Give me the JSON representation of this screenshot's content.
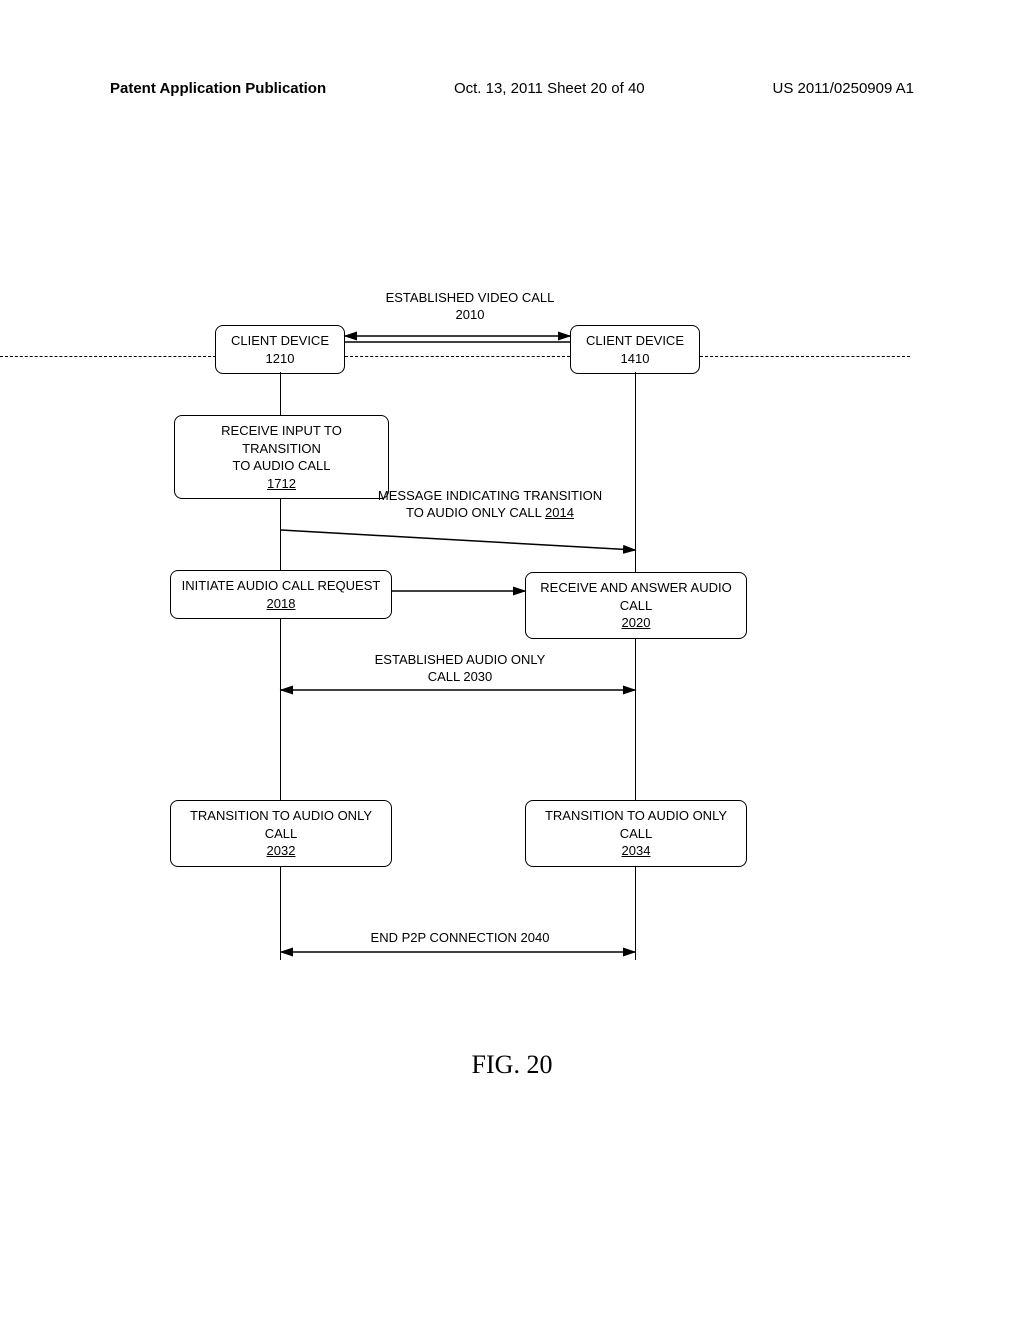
{
  "header": {
    "left": "Patent Application Publication",
    "center": "Oct. 13, 2011   Sheet 20 of 40",
    "right": "US 2011/0250909 A1"
  },
  "top_label": {
    "line1": "ESTABLISHED VIDEO CALL",
    "line2": "2010"
  },
  "client_left": {
    "line1": "CLIENT DEVICE",
    "line2": "1210"
  },
  "client_right": {
    "line1": "CLIENT DEVICE",
    "line2": "1410"
  },
  "box_receive_input": {
    "line1": "RECEIVE INPUT TO TRANSITION",
    "line2": "TO AUDIO CALL",
    "ref": "1712"
  },
  "msg_transition": {
    "line1": "MESSAGE INDICATING TRANSITION",
    "line2": "TO AUDIO ONLY CALL ",
    "ref": "2014"
  },
  "box_initiate": {
    "line1": "INITIATE AUDIO CALL REQUEST",
    "ref": "2018"
  },
  "box_receive_answer": {
    "line1": "RECEIVE AND ANSWER AUDIO",
    "line2": "CALL",
    "ref": "2020"
  },
  "audio_only_label": {
    "line1": "ESTABLISHED AUDIO ONLY",
    "line2": "CALL 2030"
  },
  "box_transition_left": {
    "line1": "TRANSITION TO AUDIO ONLY",
    "line2": "CALL",
    "ref": "2032"
  },
  "box_transition_right": {
    "line1": "TRANSITION TO AUDIO ONLY",
    "line2": "CALL",
    "ref": "2034"
  },
  "end_p2p": "END P2P CONNECTION  2040",
  "figure_caption": "FIG. 20"
}
